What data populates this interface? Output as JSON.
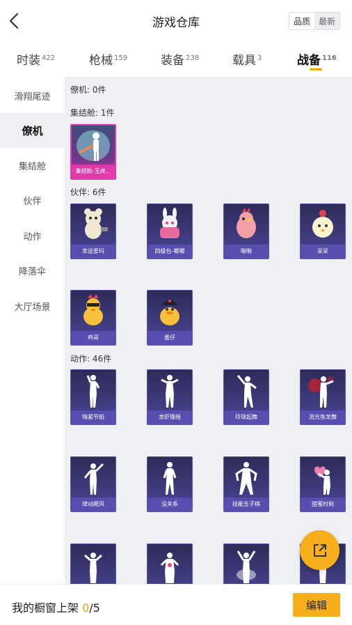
{
  "header": {
    "title": "游戏仓库",
    "sort_quality": "品质",
    "sort_newest": "最新"
  },
  "tabs": [
    {
      "label": "时装",
      "count": "422"
    },
    {
      "label": "枪械",
      "count": "159"
    },
    {
      "label": "装备",
      "count": "238"
    },
    {
      "label": "载具",
      "count": "3"
    },
    {
      "label": "战备",
      "count": "116"
    }
  ],
  "active_tab_color": "#f5a400",
  "sidebar": {
    "items": [
      {
        "label": "滑翔尾迹"
      },
      {
        "label": "僚机"
      },
      {
        "label": "集结舱"
      },
      {
        "label": "伙伴"
      },
      {
        "label": "动作"
      },
      {
        "label": "降落伞"
      },
      {
        "label": "大厅场景"
      }
    ]
  },
  "sections": {
    "wingman": {
      "title": "僚机: 0件"
    },
    "pod": {
      "title": "集结舱: 1件",
      "items": [
        {
          "label": "集结舱-玉虎..."
        }
      ]
    },
    "partner": {
      "title": "伙伴: 6件",
      "items": [
        {
          "label": "幸运爱玛"
        },
        {
          "label": "四级包-嘟嘟"
        },
        {
          "label": "啾啾"
        },
        {
          "label": "呆呆"
        },
        {
          "label": "鸡哥"
        },
        {
          "label": "羞仔"
        }
      ]
    },
    "emote": {
      "title": "动作: 46件",
      "items": [
        {
          "label": "嗨紧节拍"
        },
        {
          "label": "龙虾慢摇"
        },
        {
          "label": "玲珑起舞"
        },
        {
          "label": "流光鱼龙舞"
        },
        {
          "label": "律动飓风"
        },
        {
          "label": "没关系"
        },
        {
          "label": "技能五子棋"
        },
        {
          "label": "甜蜜时刻"
        },
        {
          "label": ""
        },
        {
          "label": ""
        },
        {
          "label": ""
        },
        {
          "label": ""
        }
      ]
    }
  },
  "bottom": {
    "showcase_prefix": "我的橱窗上架 ",
    "showcase_count": "0",
    "showcase_total": "/5",
    "edit_label": "编辑"
  },
  "icons": {
    "back": "chevron-left-icon",
    "share": "share-icon"
  }
}
